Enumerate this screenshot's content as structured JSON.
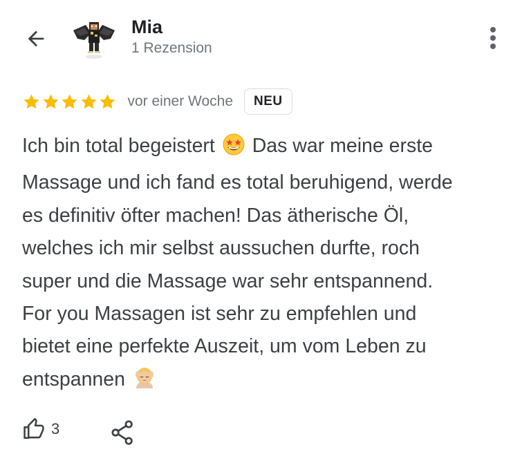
{
  "header": {
    "back_icon": "arrow-back-icon",
    "reviewer_name": "Mia",
    "review_count": "1 Rezension",
    "more_icon": "more-vert-icon"
  },
  "review": {
    "rating": 5,
    "rating_max": 5,
    "star_color": "#fbbc04",
    "date": "vor einer Woche",
    "badge": "NEU",
    "text_1": "Ich bin total begeistert",
    "text_2": "Das war meine erste\nMassage und ich fand es total beruhigend, werde\nes definitiv öfter machen! Das ätherische Öl,\nwelches ich mir selbst aussuchen durfte, roch\nsuper und die Massage war sehr entspannend.\nFor you Massagen ist sehr zu empfehlen und\nbietet eine perfekte Auszeit, um vom Leben zu\nentspannen",
    "emoji_1": "star-struck-emoji",
    "emoji_2": "person-getting-massage-emoji"
  },
  "actions": {
    "like_icon": "thumbs-up-icon",
    "like_count": "3",
    "share_icon": "share-icon"
  }
}
